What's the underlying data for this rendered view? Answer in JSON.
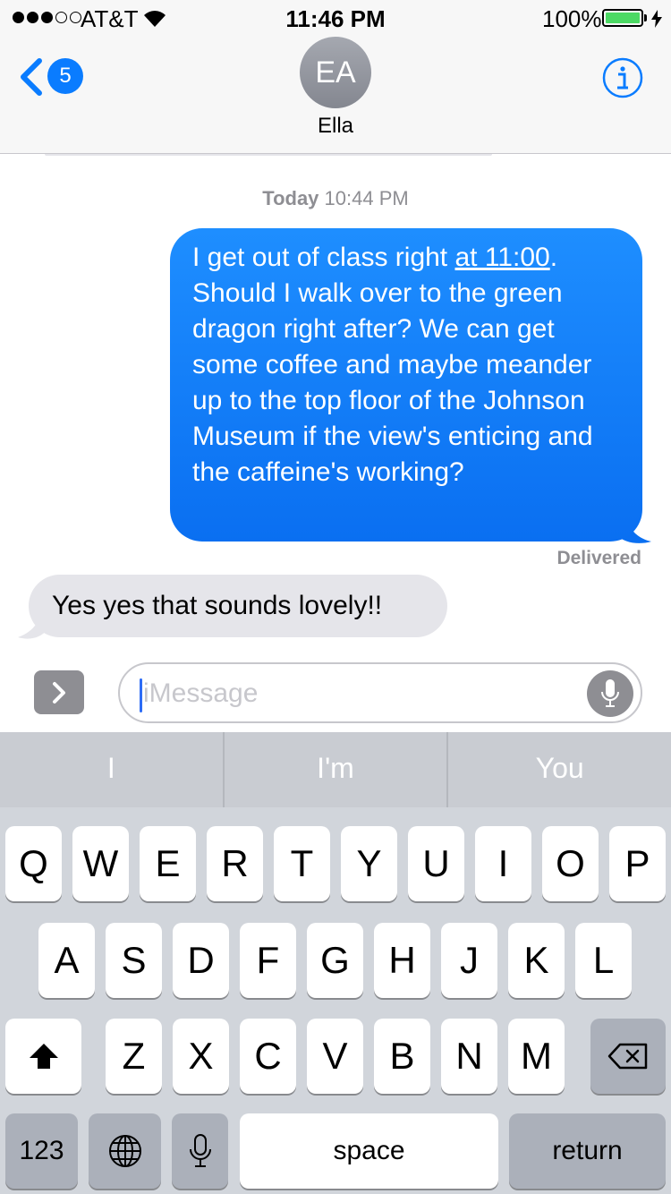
{
  "status_bar": {
    "carrier": "AT&T",
    "time": "11:46 PM",
    "battery": "100%",
    "signal_bars_filled": 3,
    "signal_bars_total": 5
  },
  "header": {
    "back_badge": "5",
    "avatar_initials": "EA",
    "contact_name": "Ella",
    "icons": {
      "back": "chevron-left-icon",
      "info": "info-circle-icon"
    }
  },
  "conversation": {
    "timestamp_day": "Today",
    "timestamp_time": "10:44 PM",
    "sent": {
      "text_before_link": "I get out of class right ",
      "link_text": "at 11:00",
      "text_after_link": ". Should I walk over to the green dragon right after? We can get some coffee and maybe meander up to the top floor of the Johnson Museum if the view's enticing and the caffeine's working?"
    },
    "delivered_label": "Delivered",
    "received": {
      "text": "Yes yes that sounds lovely!!"
    }
  },
  "input": {
    "placeholder": "iMessage",
    "icons": {
      "apps": "chevron-right-icon",
      "mic": "microphone-icon"
    }
  },
  "keyboard": {
    "predictions": [
      "I",
      "I'm",
      "You"
    ],
    "row1": [
      "Q",
      "W",
      "E",
      "R",
      "T",
      "Y",
      "U",
      "I",
      "O",
      "P"
    ],
    "row2": [
      "A",
      "S",
      "D",
      "F",
      "G",
      "H",
      "J",
      "K",
      "L"
    ],
    "row3": [
      "Z",
      "X",
      "C",
      "V",
      "B",
      "N",
      "M"
    ],
    "numbers_label": "123",
    "space_label": "space",
    "return_label": "return",
    "icons": {
      "shift": "shift-icon",
      "delete": "delete-icon",
      "globe": "globe-icon",
      "dictation": "microphone-icon"
    }
  },
  "colors": {
    "accent": "#0a7cff",
    "sent_bubble": "#1e8eff",
    "received_bubble": "#e5e5ea",
    "battery": "#4cd964"
  }
}
